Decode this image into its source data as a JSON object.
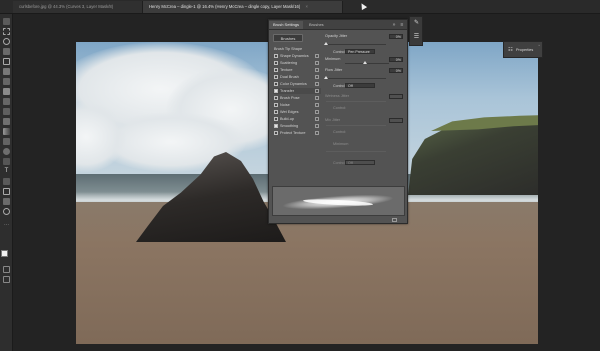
{
  "tabs": [
    {
      "label": "curlsbefore.jpg @ 44.3% (Curves 3, Layer Mask/8)",
      "active": false
    },
    {
      "label": "Henry McCrea – dingle-1 @ 16.4% (Henry McCrea – dingle copy, Layer Mask/16)",
      "active": true
    }
  ],
  "brush_settings": {
    "tab_active": "Brush Settings",
    "tab_other": "Brushes",
    "brushes_button": "Brushes",
    "list_header": "Brush Tip Shape",
    "options": [
      {
        "label": "Shape Dynamics",
        "checked": false
      },
      {
        "label": "Scattering",
        "checked": false
      },
      {
        "label": "Texture",
        "checked": false
      },
      {
        "label": "Dual Brush",
        "checked": false
      },
      {
        "label": "Color Dynamics",
        "checked": false
      },
      {
        "label": "Transfer",
        "checked": true
      },
      {
        "label": "Brush Pose",
        "checked": false
      },
      {
        "label": "Noise",
        "checked": false
      },
      {
        "label": "Wet Edges",
        "checked": false
      },
      {
        "label": "Build-up",
        "checked": false
      },
      {
        "label": "Smoothing",
        "checked": true
      },
      {
        "label": "Protect Texture",
        "checked": false
      }
    ],
    "opacity_jitter": {
      "label": "Opacity Jitter",
      "value": "0%",
      "level": 0
    },
    "control1": {
      "label": "Control:",
      "value": "Pen Pressure"
    },
    "minimum": {
      "label": "Minimum",
      "value": "0%",
      "level": 0.45
    },
    "flow_jitter": {
      "label": "Flow Jitter",
      "value": "0%",
      "level": 0
    },
    "control2": {
      "label": "Control:",
      "value": "Off"
    },
    "dim_rows": [
      {
        "label": "Wetness Jitter",
        "value": ""
      },
      {
        "label": "Control:",
        "value": ""
      },
      {
        "label": "Mix Jitter",
        "value": ""
      },
      {
        "label": "Control:",
        "value": ""
      },
      {
        "label": "Minimum",
        "value": ""
      }
    ],
    "dim_control": {
      "label": "Control:",
      "value": "Off"
    }
  },
  "properties": {
    "label": "Properties"
  },
  "icons": {
    "tab_close": "close-icon",
    "panel_menu": "menu-icon",
    "panel_collapse": "collapse-icon",
    "dock_brush": "brush-icon",
    "dock_adjust": "sliders-icon",
    "properties": "properties-icon",
    "new_preset": "new-preset-icon"
  },
  "colors": {
    "foreground": "#f2f2f2",
    "background": "#111111",
    "panel": "#535353"
  }
}
